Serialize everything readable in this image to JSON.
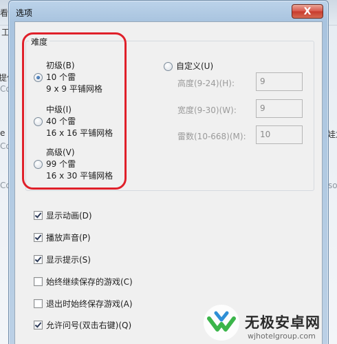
{
  "background_app": {
    "fragments": [
      "看(",
      "工",
      "提供",
      "Co",
      "e",
      "Co",
      "Co",
      "娃龙",
      "so"
    ]
  },
  "dialog": {
    "title": "选项",
    "close_symbol": "X"
  },
  "difficulty": {
    "group_title": "难度",
    "options": [
      {
        "label": "初级(B)",
        "line2": "10 个雷",
        "line3": "9 x 9 平铺网格",
        "checked": true
      },
      {
        "label": "中级(I)",
        "line2": "40 个雷",
        "line3": "16 x 16 平铺网格",
        "checked": false
      },
      {
        "label": "高级(V)",
        "line2": "99 个雷",
        "line3": "16 x 30 平铺网格",
        "checked": false
      }
    ],
    "custom": {
      "label": "自定义(U)",
      "checked": false,
      "fields": [
        {
          "label": "高度(9-24)(H):",
          "value": "9"
        },
        {
          "label": "宽度(9-30)(W):",
          "value": "9"
        },
        {
          "label": "雷数(10-668)(M):",
          "value": "10"
        }
      ]
    }
  },
  "checkboxes": [
    {
      "label": "显示动画(D)",
      "checked": true
    },
    {
      "label": "播放声音(P)",
      "checked": true
    },
    {
      "label": "显示提示(S)",
      "checked": true
    },
    {
      "label": "始终继续保存的游戏(C)",
      "checked": false
    },
    {
      "label": "退出时始终保存游戏(A)",
      "checked": false
    },
    {
      "label": "允许问号(双击右键)(Q)",
      "checked": true
    }
  ],
  "watermark": {
    "title": "无极安卓网",
    "subtitle": "wjhotelgroup.com"
  },
  "colors": {
    "highlight": "#e0202a",
    "watermark_green": "#3bb54a"
  }
}
